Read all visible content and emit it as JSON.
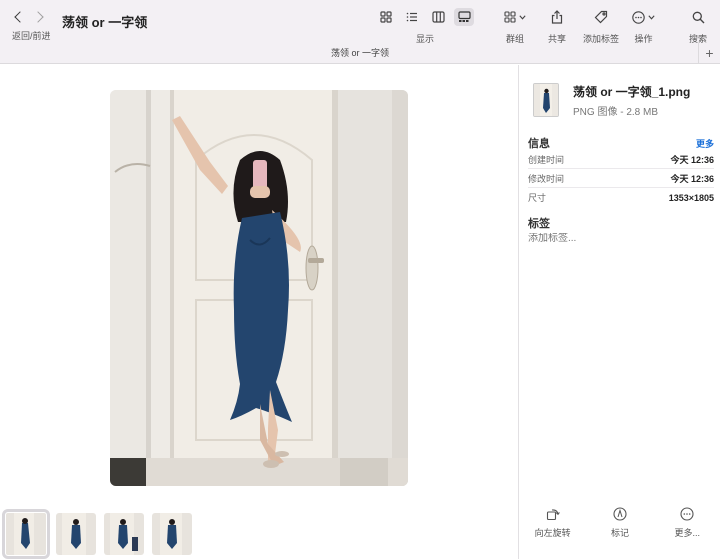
{
  "window": {
    "title": "荡领 or 一字领",
    "subtitle": "荡领 or 一字领",
    "nav_label": "返回/前进",
    "add_tab": "+"
  },
  "toolbar": {
    "display_label": "显示",
    "group_label": "群组",
    "share_label": "共享",
    "add_tag_label": "添加标签",
    "action_label": "操作",
    "search_label": "搜索",
    "views": [
      "icon-view-icon",
      "list-view-icon",
      "column-view-icon",
      "gallery-view-icon"
    ],
    "selected_view": "gallery-view-icon"
  },
  "inspector": {
    "file_name": "荡领 or 一字领_1.png",
    "file_kind": "PNG 图像 - 2.8 MB",
    "info_title": "信息",
    "more_label": "更多",
    "rows": [
      {
        "key": "创建时间",
        "value": "今天 12:36"
      },
      {
        "key": "修改时间",
        "value": "今天 12:36"
      },
      {
        "key": "尺寸",
        "value": "1353×1805"
      }
    ],
    "tags_title": "标签",
    "tags_placeholder": "添加标签..."
  },
  "actions": {
    "rotate_left_label": "向左旋转",
    "markup_label": "标记",
    "more_label": "更多..."
  },
  "thumbnails": {
    "count": 4,
    "selected_index": 0
  },
  "colors": {
    "toolbar_bg": "#f3f0f4",
    "accent": "#1a6fd8",
    "dress": "#23456e"
  }
}
